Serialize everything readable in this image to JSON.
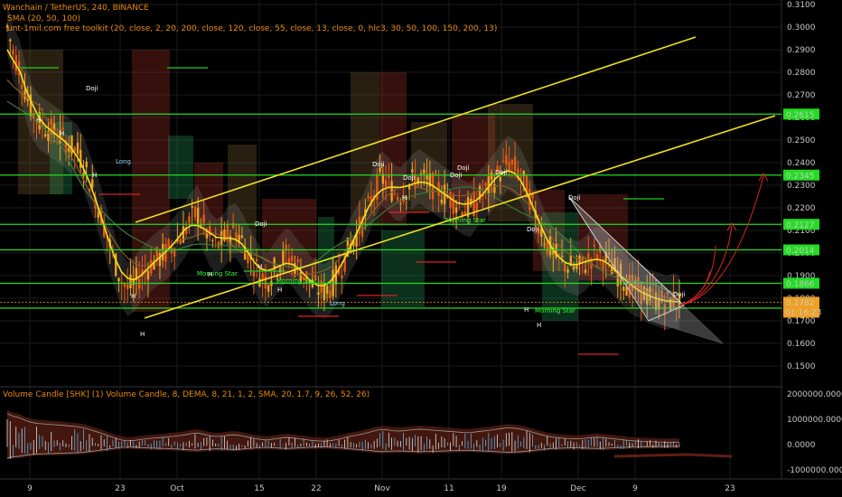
{
  "header": {
    "title": "Wanchain / TetherUS, 240, BINANCE",
    "sma": "SMA (20, 50, 100)",
    "toolkit": "unt-1mil.com free toolkit (20, close, 2, 20, 200, close, 120, close, 55, close, 13, close, 0, hlc3, 30, 50, 100, 150, 200, 13)",
    "volume": "Volume Candle [SHK] (1) Volume Candle, 8, DEMA, 8, 21, 1, 2, SMA, 20, 1.7, 9, 26, 52, 26)"
  },
  "chart_data": [
    {
      "type": "candlestick",
      "pane": "price",
      "y_ticks": [
        "0.3100",
        "0.3000",
        "0.2900",
        "0.2800",
        "0.2700",
        "0.2600",
        "0.2500",
        "0.2400",
        "0.2300",
        "0.2200",
        "0.2100",
        "0.2000",
        "0.1900",
        "0.1800",
        "0.1700",
        "0.1600",
        "0.1500"
      ],
      "ylim": [
        0.145,
        0.31
      ],
      "x_ticks": [
        "9",
        "23",
        "Oct",
        "15",
        "22",
        "Nov",
        "11",
        "19",
        "Dec",
        "9",
        "23"
      ],
      "levels": [
        {
          "value": "0.2615",
          "color": "#22dd22"
        },
        {
          "value": "0.2345",
          "color": "#22dd22"
        },
        {
          "value": "0.2127",
          "color": "#22dd22"
        },
        {
          "value": "0.2014",
          "color": "#22dd22"
        },
        {
          "value": "0.1866",
          "color": "#22dd22"
        },
        {
          "value": "0.1756",
          "color": "#22dd22"
        }
      ],
      "current_price": {
        "price": "0.1782",
        "countdown": "01:16:23",
        "color": "#f0a020"
      },
      "pattern_labels": [
        "Doji",
        "Doji",
        "Doji",
        "Doji",
        "Doji",
        "Doji",
        "Doji",
        "Doji",
        "Doji",
        "Doji",
        "Morning Star",
        "Morning Star",
        "Morning Star",
        "Morning Star",
        "Long",
        "Long",
        "H",
        "H",
        "H",
        "H",
        "H",
        "H",
        "H",
        "H",
        "H",
        "H",
        "H"
      ],
      "sma_color": "#f2e020",
      "trendline_color": "#f2e020",
      "triangle_color": "#cccccc",
      "projection_color": "#dd2222",
      "close_series": [
        0.3,
        0.288,
        0.282,
        0.27,
        0.262,
        0.258,
        0.256,
        0.254,
        0.252,
        0.25,
        0.247,
        0.245,
        0.24,
        0.232,
        0.224,
        0.215,
        0.205,
        0.196,
        0.188,
        0.184,
        0.186,
        0.19,
        0.193,
        0.196,
        0.198,
        0.2,
        0.203,
        0.206,
        0.21,
        0.215,
        0.218,
        0.212,
        0.206,
        0.203,
        0.205,
        0.209,
        0.21,
        0.206,
        0.2,
        0.195,
        0.19,
        0.188,
        0.192,
        0.196,
        0.199,
        0.197,
        0.193,
        0.19,
        0.186,
        0.184,
        0.183,
        0.185,
        0.19,
        0.196,
        0.203,
        0.208,
        0.213,
        0.22,
        0.228,
        0.233,
        0.231,
        0.227,
        0.226,
        0.229,
        0.232,
        0.234,
        0.232,
        0.23,
        0.228,
        0.226,
        0.224,
        0.222,
        0.22,
        0.219,
        0.223,
        0.226,
        0.229,
        0.233,
        0.237,
        0.24,
        0.238,
        0.234,
        0.228,
        0.22,
        0.212,
        0.205,
        0.2,
        0.197,
        0.195,
        0.194,
        0.193,
        0.195,
        0.198,
        0.2,
        0.198,
        0.195,
        0.192,
        0.189,
        0.186,
        0.184,
        0.183,
        0.181,
        0.18,
        0.179,
        0.178,
        0.179,
        0.1782
      ]
    },
    {
      "type": "volume",
      "pane": "volume",
      "y_ticks": [
        "2000000.0000",
        "1000000.0000",
        "0.0000",
        "-1000000.0000"
      ],
      "ylim": [
        -1100000,
        2100000
      ]
    }
  ]
}
